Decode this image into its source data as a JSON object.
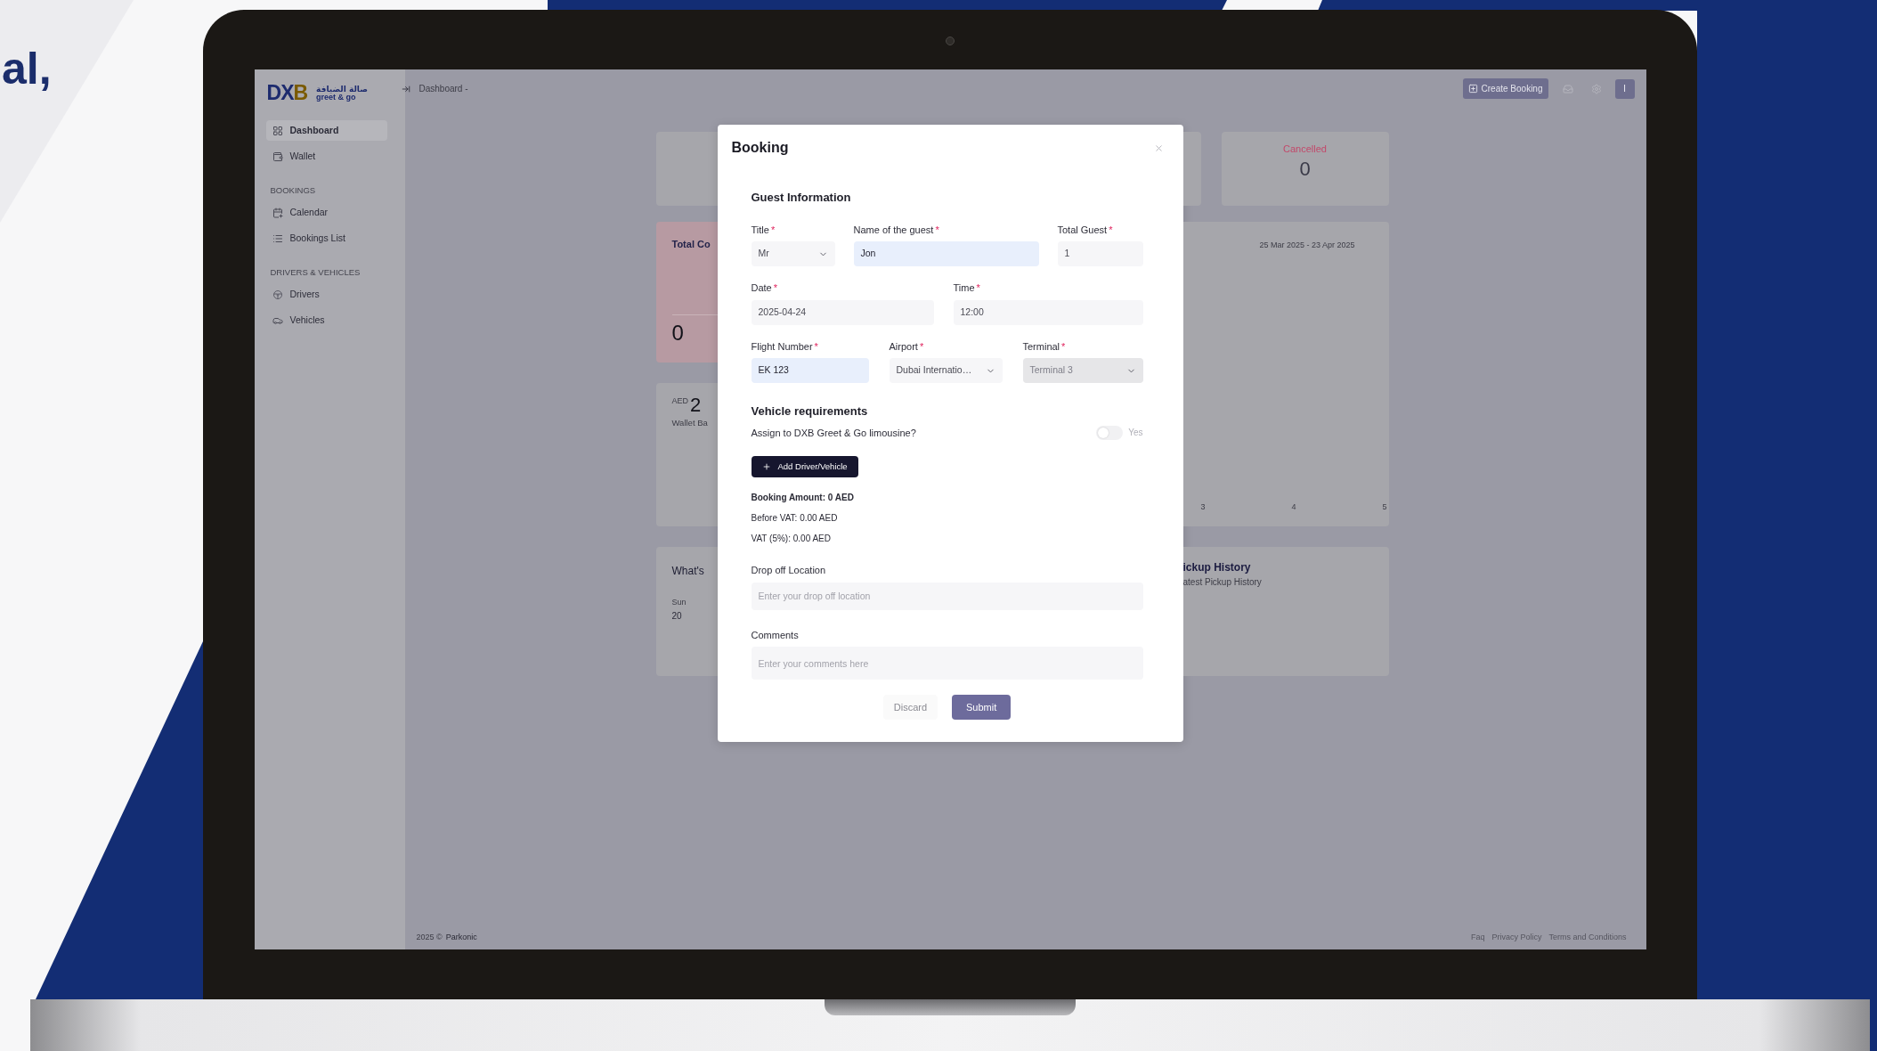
{
  "tagline_fragment": "al,",
  "sidebar": {
    "logo": {
      "mark": "DXB",
      "arabic": "صالة الضيافة",
      "name": "greet & go"
    },
    "groups": [
      {
        "items": [
          {
            "label": "Dashboard",
            "selected": true
          },
          {
            "label": "Wallet",
            "selected": false
          }
        ]
      },
      {
        "heading": "BOOKINGS",
        "items": [
          {
            "label": "Calendar",
            "selected": false
          },
          {
            "label": "Bookings List",
            "selected": false
          }
        ]
      },
      {
        "heading": "DRIVERS & VEHICLES",
        "items": [
          {
            "label": "Drivers",
            "selected": false
          },
          {
            "label": "Vehicles",
            "selected": false
          }
        ]
      }
    ]
  },
  "header": {
    "breadcrumb": "Dashboard -",
    "create_button": "Create Booking",
    "avatar": "I"
  },
  "dashboard": {
    "total_card": {
      "title": "Total Co",
      "value": "0"
    },
    "wallet_card": {
      "currency": "AED",
      "amount": "2",
      "caption": "Wallet Ba"
    },
    "upcoming_card": {
      "title": "What's",
      "day": "Sun",
      "date": "20"
    },
    "cancelled_card": {
      "label": "Cancelled",
      "value": "0"
    },
    "chart_card": {
      "range": "25 Mar 2025 - 23 Apr 2025",
      "x_labels": [
        "3",
        "4",
        "5"
      ]
    },
    "pickup_card": {
      "title": "ickup History",
      "subtitle": "atest Pickup History"
    }
  },
  "booking_modal": {
    "title": "Booking",
    "guest_heading": "Guest Information",
    "rows": [
      [
        {
          "label": "Title",
          "required_mark": "*",
          "kind": "select",
          "value": "Mr",
          "autofilled": false,
          "disabled": false
        },
        {
          "label": "Name of the guest",
          "required_mark": "*",
          "kind": "input",
          "value": "Jon",
          "autofilled": true,
          "disabled": false
        },
        {
          "label": "Total Guest",
          "required_mark": "*",
          "kind": "input",
          "value": "1",
          "autofilled": false,
          "disabled": false
        }
      ],
      [
        {
          "label": "Date",
          "required_mark": "*",
          "kind": "input",
          "value": "2025-04-24",
          "autofilled": false,
          "disabled": false
        },
        {
          "label": "Time",
          "required_mark": "*",
          "kind": "input",
          "value": "12:00",
          "autofilled": false,
          "disabled": false
        }
      ],
      [
        {
          "label": "Flight Number",
          "required_mark": "*",
          "kind": "input",
          "value": "EK 123",
          "autofilled": true,
          "disabled": false
        },
        {
          "label": "Airport",
          "required_mark": "*",
          "kind": "select",
          "value": "Dubai Internatio…",
          "autofilled": false,
          "disabled": false
        },
        {
          "label": "Terminal",
          "required_mark": "*",
          "kind": "select",
          "value": "Terminal 3",
          "autofilled": false,
          "disabled": true
        }
      ]
    ],
    "vehicle_heading": "Vehicle requirements",
    "assign": {
      "label": "Assign to DXB Greet & Go limousine?",
      "on": false,
      "state_label": "Yes"
    },
    "add_button": "Add Driver/Vehicle",
    "amounts": [
      {
        "text": "Booking Amount: 0 AED",
        "bold": true
      },
      {
        "text": "Before VAT: 0.00 AED",
        "bold": false
      },
      {
        "text": "VAT (5%): 0.00 AED",
        "bold": false
      }
    ],
    "dropoff": {
      "label": "Drop off Location",
      "placeholder": "Enter your drop off location"
    },
    "comments": {
      "label": "Comments",
      "placeholder": "Enter your comments here"
    },
    "discard": "Discard",
    "submit": "Submit"
  },
  "footer": {
    "year": "2025 ©",
    "company": "Parkonic",
    "links": [
      "Faq",
      "Privacy Policy",
      "Terms and Conditions"
    ]
  }
}
